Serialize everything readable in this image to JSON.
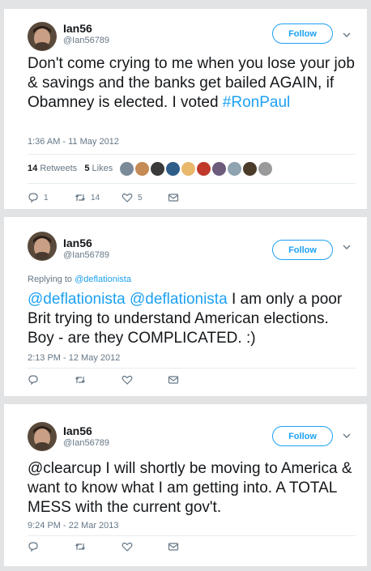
{
  "tweets": [
    {
      "name": "Ian56",
      "handle": "@Ian56789",
      "follow_label": "Follow",
      "reply_to_prefix": "",
      "reply_to_user": "",
      "text_parts": [
        {
          "text": "Don't come crying to me when you lose your job & savings and the banks get bailed AGAIN, if Obamney is elected. I voted ",
          "kind": "plain"
        },
        {
          "text": "#RonPaul",
          "kind": "hashtag"
        }
      ],
      "timestamp": "1:36 AM - 11 May 2012",
      "retweets_count": "14",
      "retweets_label": "Retweets",
      "likes_count": "5",
      "likes_label": "Likes",
      "reply_count": "1",
      "retweet_count": "14",
      "like_count": "5"
    },
    {
      "name": "Ian56",
      "handle": "@Ian56789",
      "follow_label": "Follow",
      "reply_to_prefix": "Replying to ",
      "reply_to_user": "@deflationista",
      "text_parts": [
        {
          "text": "@deflationista @deflationista",
          "kind": "mention"
        },
        {
          "text": " I am only a poor Brit trying to understand American elections. Boy - are they COMPLICATED. :)",
          "kind": "plain"
        }
      ],
      "timestamp": "2:13 PM - 12 May 2012",
      "reply_count": "",
      "retweet_count": "",
      "like_count": ""
    },
    {
      "name": "Ian56",
      "handle": "@Ian56789",
      "follow_label": "Follow",
      "reply_to_prefix": "",
      "reply_to_user": "",
      "text_parts": [
        {
          "text": "@clearcup I will shortly be moving to America & want to know what I am getting into. A TOTAL MESS with the current gov't.",
          "kind": "plain"
        }
      ],
      "timestamp": "9:24 PM - 22 Mar 2013",
      "reply_count": "",
      "retweet_count": "",
      "like_count": ""
    }
  ],
  "likers": [
    "#7b8a99",
    "#c58a55",
    "#3a3a3a",
    "#2f5d8a",
    "#e8b86d",
    "#c0392b",
    "#6c5b7b",
    "#8fa3b0",
    "#4a3b2a",
    "#9a9a9a"
  ],
  "colors": {
    "accent": "#1da1f2",
    "secondary": "#657786",
    "text": "#14171a",
    "background": "#e1e3e5"
  }
}
